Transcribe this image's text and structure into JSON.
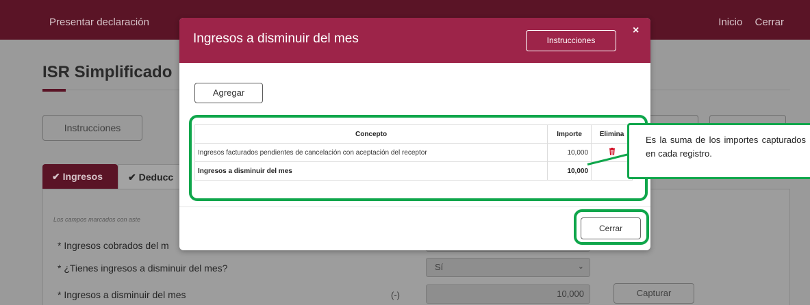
{
  "background": {
    "topbar": {
      "brand": "Presentar declaración",
      "links": [
        "Inicio",
        "Cerrar"
      ]
    },
    "title": "ISR Simplificado",
    "instructions_button": "Instrucciones",
    "tabs": [
      {
        "label": "Ingresos"
      },
      {
        "label": "Deducc"
      }
    ],
    "note": "Los campos marcados con aste",
    "fields": [
      {
        "label": "* Ingresos cobrados del m"
      },
      {
        "label": "* ¿Tienes ingresos a disminuir del mes?",
        "value": "Sí"
      },
      {
        "label": "* Ingresos a disminuir del mes",
        "sign": "(-)",
        "value": "10,000",
        "button": "Capturar"
      }
    ]
  },
  "modal": {
    "title": "Ingresos a disminuir del mes",
    "instructions_button": "Instrucciones",
    "close_glyph": "×",
    "add_button": "Agregar",
    "table": {
      "headers": [
        "Concepto",
        "Importe",
        "Elimina"
      ],
      "rows": [
        {
          "concepto": "Ingresos facturados pendientes de cancelación con aceptación del receptor",
          "importe": "10,000"
        }
      ],
      "total": {
        "concepto": "Ingresos a disminuir del mes",
        "importe": "10,000"
      }
    },
    "close_button": "Cerrar"
  },
  "callout": {
    "text": "Es la suma de los importes capturados en cada registro."
  },
  "colors": {
    "accent": "#9d2449",
    "highlight": "#0fa64b",
    "topbar_dim": "#5a1426"
  },
  "icons": {
    "check": "check-icon",
    "chevron": "chevron-down-icon",
    "close": "close-icon",
    "delete": "trash-icon"
  }
}
